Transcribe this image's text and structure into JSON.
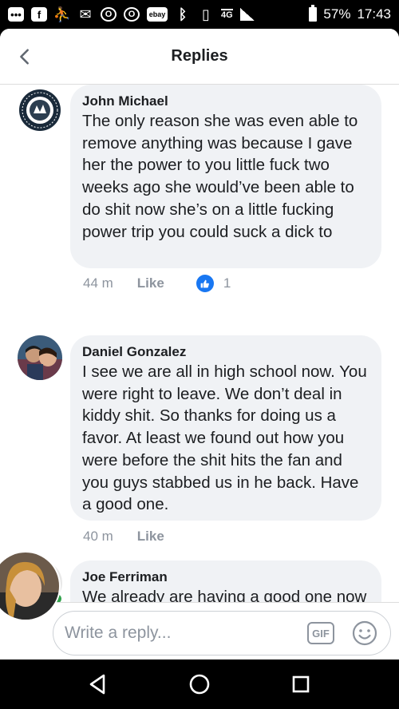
{
  "status_bar": {
    "icons": [
      "chat-icon",
      "facebook-icon",
      "add-friend-icon",
      "mail-icon",
      "opera-icon",
      "opera-icon",
      "ebay-icon",
      "bluetooth-icon",
      "vibrate-icon",
      "4g-lte-icon",
      "signal-icon",
      "battery-icon"
    ],
    "ebay_label": "ebay",
    "network": "4G",
    "battery": "57%",
    "time": "17:43"
  },
  "header": {
    "title": "Replies"
  },
  "comments": [
    {
      "author": "John Michael",
      "text": "The only reason she was even able to remove anything was because I gave her the power to you little fuck two weeks ago she would’ve been able to do shit now she’s on a little fucking power trip you could suck a dick to",
      "time": "44 m",
      "like_label": "Like",
      "reaction_count": "1",
      "avatar_text": "HUNTING TEAM"
    },
    {
      "author": "Daniel Gonzalez",
      "text": "I see we are all in high school now. You were right to leave. We don’t deal in kiddy shit. So thanks for doing us a favor. At least we found out how you were before the shit hits the fan and you guys stabbed us in he back. Have a good one.",
      "time": "40 m",
      "like_label": "Like"
    },
    {
      "author": "Joe Ferriman",
      "text": "We already are having a good one now that we dropped all the dead",
      "online": true
    }
  ],
  "composer": {
    "placeholder": "Write a reply...",
    "gif_label": "GIF"
  },
  "colors": {
    "bubble": "#f0f2f5",
    "accent": "#1877f2",
    "online": "#31a24c",
    "muted": "#8d949e"
  }
}
